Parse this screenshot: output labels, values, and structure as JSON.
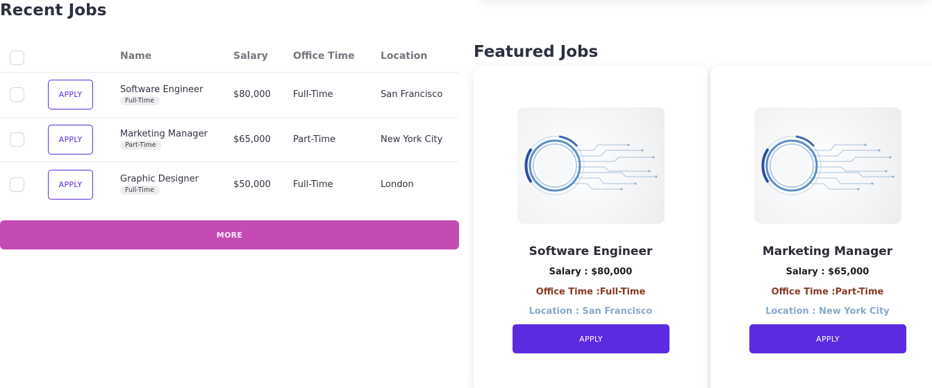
{
  "recent_jobs": {
    "title": "Recent Jobs",
    "columns": [
      "Name",
      "Salary",
      "Office Time",
      "Location"
    ],
    "apply_label": "APPLY",
    "rows": [
      {
        "name": "Software Engineer",
        "tag": "Full-Time",
        "salary": "$80,000",
        "office_time": "Full-Time",
        "location": "San Francisco"
      },
      {
        "name": "Marketing Manager",
        "tag": "Part-Time",
        "salary": "$65,000",
        "office_time": "Part-Time",
        "location": "New York City"
      },
      {
        "name": "Graphic Designer",
        "tag": "Full-Time",
        "salary": "$50,000",
        "office_time": "Full-Time",
        "location": "London"
      }
    ],
    "more_label": "MORE",
    "more_color": "#c44bb4"
  },
  "featured_jobs": {
    "title": "Featured Jobs",
    "cards": [
      {
        "title": "Software Engineer",
        "salary": "Salary : $80,000",
        "office_time": "Office Time :Full-Time",
        "location": "Location : San Francisco",
        "apply_label": "APPLY",
        "image_icon": "circuit-ring-image"
      },
      {
        "title": "Marketing Manager",
        "salary": "Salary : $65,000",
        "office_time": "Office Time :Part-Time",
        "location": "Location : New York City",
        "apply_label": "APPLY",
        "image_icon": "circuit-ring-image"
      }
    ]
  },
  "colors": {
    "primary": "#5b2be0",
    "office_time": "#8a3a24",
    "location": "#87a9c9"
  }
}
